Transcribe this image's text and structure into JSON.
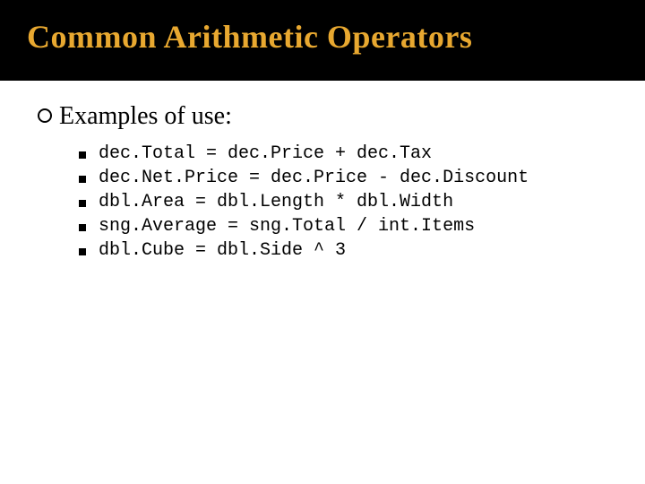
{
  "title": "Common Arithmetic Operators",
  "section_label": "Examples of use:",
  "examples": [
    "dec.Total = dec.Price + dec.Tax",
    "dec.Net.Price = dec.Price - dec.Discount",
    "dbl.Area = dbl.Length * dbl.Width",
    "sng.Average = sng.Total / int.Items",
    "dbl.Cube = dbl.Side ^ 3"
  ],
  "colors": {
    "title_bg": "#000000",
    "title_fg": "#e8a830",
    "body_bg": "#ffffff"
  }
}
